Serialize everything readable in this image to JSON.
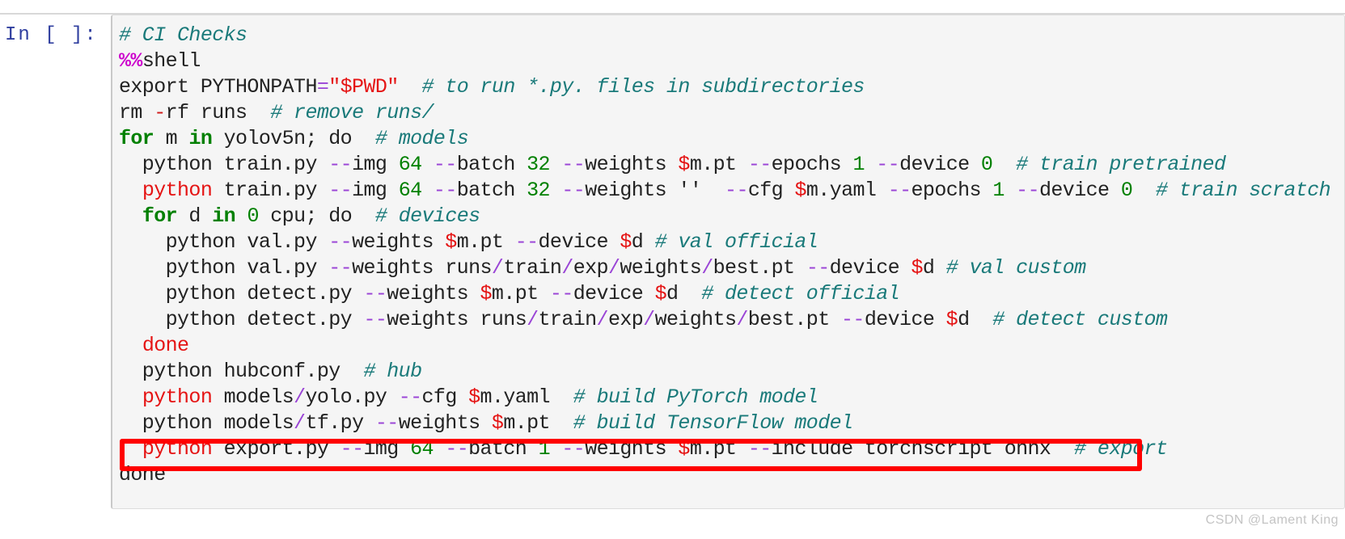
{
  "notebook": {
    "prompt": "In [ ]:",
    "watermark": "CSDN @Lament King",
    "highlight_color": "#ff0000",
    "cell_background": "#f5f5f5",
    "colors": {
      "comment": "#1a7a7a",
      "magic": "#cc00cc",
      "keyword": "#008000",
      "number": "#008000",
      "flag": "#9a44d6",
      "variable": "#e51414",
      "plain": "#222222",
      "prompt": "#303f9f",
      "watermark": "#c4c4c4"
    }
  },
  "code": {
    "language": "shell",
    "lines": [
      {
        "index": 1,
        "plain": "# CI Checks",
        "tokens": [
          {
            "t": "# CI Checks",
            "c": "comment"
          }
        ]
      },
      {
        "index": 2,
        "plain": "%%shell",
        "tokens": [
          {
            "t": "%%",
            "c": "magic"
          },
          {
            "t": "shell",
            "c": "plain"
          }
        ]
      },
      {
        "index": 3,
        "plain": "export PYTHONPATH=\"$PWD\"  # to run *.py. files in subdirectories",
        "tokens": [
          {
            "t": "export PYTHONPATH",
            "c": "plain"
          },
          {
            "t": "=",
            "c": "eq"
          },
          {
            "t": "\"",
            "c": "str"
          },
          {
            "t": "$PWD",
            "c": "var"
          },
          {
            "t": "\"",
            "c": "str"
          },
          {
            "t": "  ",
            "c": "plain"
          },
          {
            "t": "# to run *.py. files in subdirectories",
            "c": "comment"
          }
        ]
      },
      {
        "index": 4,
        "plain": "rm -rf runs  # remove runs/",
        "tokens": [
          {
            "t": "rm ",
            "c": "plain"
          },
          {
            "t": "-",
            "c": "op"
          },
          {
            "t": "rf runs  ",
            "c": "plain"
          },
          {
            "t": "# remove runs/",
            "c": "comment"
          }
        ]
      },
      {
        "index": 5,
        "plain": "for m in yolov5n; do  # models",
        "tokens": [
          {
            "t": "for",
            "c": "keyword"
          },
          {
            "t": " m ",
            "c": "plain"
          },
          {
            "t": "in",
            "c": "keyword"
          },
          {
            "t": " yolov5n; do  ",
            "c": "plain"
          },
          {
            "t": "# models",
            "c": "comment"
          }
        ]
      },
      {
        "index": 6,
        "plain": "  python train.py --img 64 --batch 32 --weights $m.pt --epochs 1 --device 0  # train pretrained",
        "tokens": [
          {
            "t": "  python train.py ",
            "c": "plain"
          },
          {
            "t": "--",
            "c": "flag"
          },
          {
            "t": "img ",
            "c": "plain"
          },
          {
            "t": "64",
            "c": "number"
          },
          {
            "t": " ",
            "c": "plain"
          },
          {
            "t": "--",
            "c": "flag"
          },
          {
            "t": "batch ",
            "c": "plain"
          },
          {
            "t": "32",
            "c": "number"
          },
          {
            "t": " ",
            "c": "plain"
          },
          {
            "t": "--",
            "c": "flag"
          },
          {
            "t": "weights ",
            "c": "plain"
          },
          {
            "t": "$",
            "c": "var"
          },
          {
            "t": "m.pt ",
            "c": "plain"
          },
          {
            "t": "--",
            "c": "flag"
          },
          {
            "t": "epochs ",
            "c": "plain"
          },
          {
            "t": "1",
            "c": "number"
          },
          {
            "t": " ",
            "c": "plain"
          },
          {
            "t": "--",
            "c": "flag"
          },
          {
            "t": "device ",
            "c": "plain"
          },
          {
            "t": "0",
            "c": "number"
          },
          {
            "t": "  ",
            "c": "plain"
          },
          {
            "t": "# train pretrained",
            "c": "comment"
          }
        ]
      },
      {
        "index": 7,
        "plain": "  python train.py --img 64 --batch 32 --weights '' --cfg $m.yaml --epochs 1 --device 0  # train scratch",
        "tokens": [
          {
            "t": "  ",
            "c": "plain"
          },
          {
            "t": "python",
            "c": "red"
          },
          {
            "t": " train.py ",
            "c": "plain"
          },
          {
            "t": "--",
            "c": "flag"
          },
          {
            "t": "img ",
            "c": "plain"
          },
          {
            "t": "64",
            "c": "number"
          },
          {
            "t": " ",
            "c": "plain"
          },
          {
            "t": "--",
            "c": "flag"
          },
          {
            "t": "batch ",
            "c": "plain"
          },
          {
            "t": "32",
            "c": "number"
          },
          {
            "t": " ",
            "c": "plain"
          },
          {
            "t": "--",
            "c": "flag"
          },
          {
            "t": "weights ",
            "c": "plain"
          },
          {
            "t": "''",
            "c": "quote"
          },
          {
            "t": "  ",
            "c": "plain"
          },
          {
            "t": "--",
            "c": "flag"
          },
          {
            "t": "cfg ",
            "c": "plain"
          },
          {
            "t": "$",
            "c": "var"
          },
          {
            "t": "m.yaml ",
            "c": "plain"
          },
          {
            "t": "--",
            "c": "flag"
          },
          {
            "t": "epochs ",
            "c": "plain"
          },
          {
            "t": "1",
            "c": "number"
          },
          {
            "t": " ",
            "c": "plain"
          },
          {
            "t": "--",
            "c": "flag"
          },
          {
            "t": "device ",
            "c": "plain"
          },
          {
            "t": "0",
            "c": "number"
          },
          {
            "t": "  ",
            "c": "plain"
          },
          {
            "t": "# train scratch",
            "c": "comment"
          }
        ]
      },
      {
        "index": 8,
        "plain": "  for d in 0 cpu; do  # devices",
        "tokens": [
          {
            "t": "  ",
            "c": "plain"
          },
          {
            "t": "for",
            "c": "keyword"
          },
          {
            "t": " d ",
            "c": "plain"
          },
          {
            "t": "in",
            "c": "keyword"
          },
          {
            "t": " ",
            "c": "plain"
          },
          {
            "t": "0",
            "c": "number"
          },
          {
            "t": " cpu; do  ",
            "c": "plain"
          },
          {
            "t": "# devices",
            "c": "comment"
          }
        ]
      },
      {
        "index": 9,
        "plain": "    python val.py --weights $m.pt --device $d # val official",
        "tokens": [
          {
            "t": "    python val.py ",
            "c": "plain"
          },
          {
            "t": "--",
            "c": "flag"
          },
          {
            "t": "weights ",
            "c": "plain"
          },
          {
            "t": "$",
            "c": "var"
          },
          {
            "t": "m.pt ",
            "c": "plain"
          },
          {
            "t": "--",
            "c": "flag"
          },
          {
            "t": "device ",
            "c": "plain"
          },
          {
            "t": "$",
            "c": "var"
          },
          {
            "t": "d ",
            "c": "plain"
          },
          {
            "t": "# val official",
            "c": "comment"
          }
        ]
      },
      {
        "index": 10,
        "plain": "    python val.py --weights runs/train/exp/weights/best.pt --device $d # val custom",
        "tokens": [
          {
            "t": "    python val.py ",
            "c": "plain"
          },
          {
            "t": "--",
            "c": "flag"
          },
          {
            "t": "weights runs",
            "c": "plain"
          },
          {
            "t": "/",
            "c": "slash"
          },
          {
            "t": "train",
            "c": "plain"
          },
          {
            "t": "/",
            "c": "slash"
          },
          {
            "t": "exp",
            "c": "plain"
          },
          {
            "t": "/",
            "c": "slash"
          },
          {
            "t": "weights",
            "c": "plain"
          },
          {
            "t": "/",
            "c": "slash"
          },
          {
            "t": "best.pt ",
            "c": "plain"
          },
          {
            "t": "--",
            "c": "flag"
          },
          {
            "t": "device ",
            "c": "plain"
          },
          {
            "t": "$",
            "c": "var"
          },
          {
            "t": "d ",
            "c": "plain"
          },
          {
            "t": "# val custom",
            "c": "comment"
          }
        ]
      },
      {
        "index": 11,
        "plain": "    python detect.py --weights $m.pt --device $d  # detect official",
        "tokens": [
          {
            "t": "    python detect.py ",
            "c": "plain"
          },
          {
            "t": "--",
            "c": "flag"
          },
          {
            "t": "weights ",
            "c": "plain"
          },
          {
            "t": "$",
            "c": "var"
          },
          {
            "t": "m.pt ",
            "c": "plain"
          },
          {
            "t": "--",
            "c": "flag"
          },
          {
            "t": "device ",
            "c": "plain"
          },
          {
            "t": "$",
            "c": "var"
          },
          {
            "t": "d  ",
            "c": "plain"
          },
          {
            "t": "# detect official",
            "c": "comment"
          }
        ]
      },
      {
        "index": 12,
        "plain": "    python detect.py --weights runs/train/exp/weights/best.pt --device $d  # detect custom",
        "tokens": [
          {
            "t": "    python detect.py ",
            "c": "plain"
          },
          {
            "t": "--",
            "c": "flag"
          },
          {
            "t": "weights runs",
            "c": "plain"
          },
          {
            "t": "/",
            "c": "slash"
          },
          {
            "t": "train",
            "c": "plain"
          },
          {
            "t": "/",
            "c": "slash"
          },
          {
            "t": "exp",
            "c": "plain"
          },
          {
            "t": "/",
            "c": "slash"
          },
          {
            "t": "weights",
            "c": "plain"
          },
          {
            "t": "/",
            "c": "slash"
          },
          {
            "t": "best.pt ",
            "c": "plain"
          },
          {
            "t": "--",
            "c": "flag"
          },
          {
            "t": "device ",
            "c": "plain"
          },
          {
            "t": "$",
            "c": "var"
          },
          {
            "t": "d  ",
            "c": "plain"
          },
          {
            "t": "# detect custom",
            "c": "comment"
          }
        ]
      },
      {
        "index": 13,
        "plain": "  done",
        "tokens": [
          {
            "t": "  ",
            "c": "plain"
          },
          {
            "t": "done",
            "c": "red"
          }
        ]
      },
      {
        "index": 14,
        "plain": "  python hubconf.py  # hub",
        "tokens": [
          {
            "t": "  python hubconf.py  ",
            "c": "plain"
          },
          {
            "t": "# hub",
            "c": "comment"
          }
        ]
      },
      {
        "index": 15,
        "plain": "  python models/yolo.py --cfg $m.yaml  # build PyTorch model",
        "tokens": [
          {
            "t": "  ",
            "c": "plain"
          },
          {
            "t": "python",
            "c": "red"
          },
          {
            "t": " models",
            "c": "plain"
          },
          {
            "t": "/",
            "c": "slash"
          },
          {
            "t": "yolo.py ",
            "c": "plain"
          },
          {
            "t": "--",
            "c": "flag"
          },
          {
            "t": "cfg ",
            "c": "plain"
          },
          {
            "t": "$",
            "c": "var"
          },
          {
            "t": "m.yaml  ",
            "c": "plain"
          },
          {
            "t": "# build PyTorch model",
            "c": "comment"
          }
        ]
      },
      {
        "index": 16,
        "plain": "  python models/tf.py --weights $m.pt  # build TensorFlow model",
        "tokens": [
          {
            "t": "  python models",
            "c": "plain"
          },
          {
            "t": "/",
            "c": "slash"
          },
          {
            "t": "tf.py ",
            "c": "plain"
          },
          {
            "t": "--",
            "c": "flag"
          },
          {
            "t": "weights ",
            "c": "plain"
          },
          {
            "t": "$",
            "c": "var"
          },
          {
            "t": "m.pt  ",
            "c": "plain"
          },
          {
            "t": "# build TensorFlow model",
            "c": "comment"
          }
        ]
      },
      {
        "index": 17,
        "highlighted": true,
        "plain": "  python export.py --img 64 --batch 1 --weights $m.pt --include torchscript onnx  # export",
        "tokens": [
          {
            "t": "  ",
            "c": "plain"
          },
          {
            "t": "python",
            "c": "red"
          },
          {
            "t": " export.py ",
            "c": "plain"
          },
          {
            "t": "--",
            "c": "flag"
          },
          {
            "t": "img ",
            "c": "plain"
          },
          {
            "t": "64",
            "c": "number"
          },
          {
            "t": " ",
            "c": "plain"
          },
          {
            "t": "--",
            "c": "flag"
          },
          {
            "t": "batch ",
            "c": "plain"
          },
          {
            "t": "1",
            "c": "number"
          },
          {
            "t": " ",
            "c": "plain"
          },
          {
            "t": "--",
            "c": "flag"
          },
          {
            "t": "weights ",
            "c": "plain"
          },
          {
            "t": "$",
            "c": "var"
          },
          {
            "t": "m.pt ",
            "c": "plain"
          },
          {
            "t": "--",
            "c": "flag"
          },
          {
            "t": "include torchscript onnx  ",
            "c": "plain"
          },
          {
            "t": "# export",
            "c": "comment"
          }
        ]
      },
      {
        "index": 18,
        "plain": "done",
        "tokens": [
          {
            "t": "done",
            "c": "plain"
          }
        ]
      }
    ]
  }
}
